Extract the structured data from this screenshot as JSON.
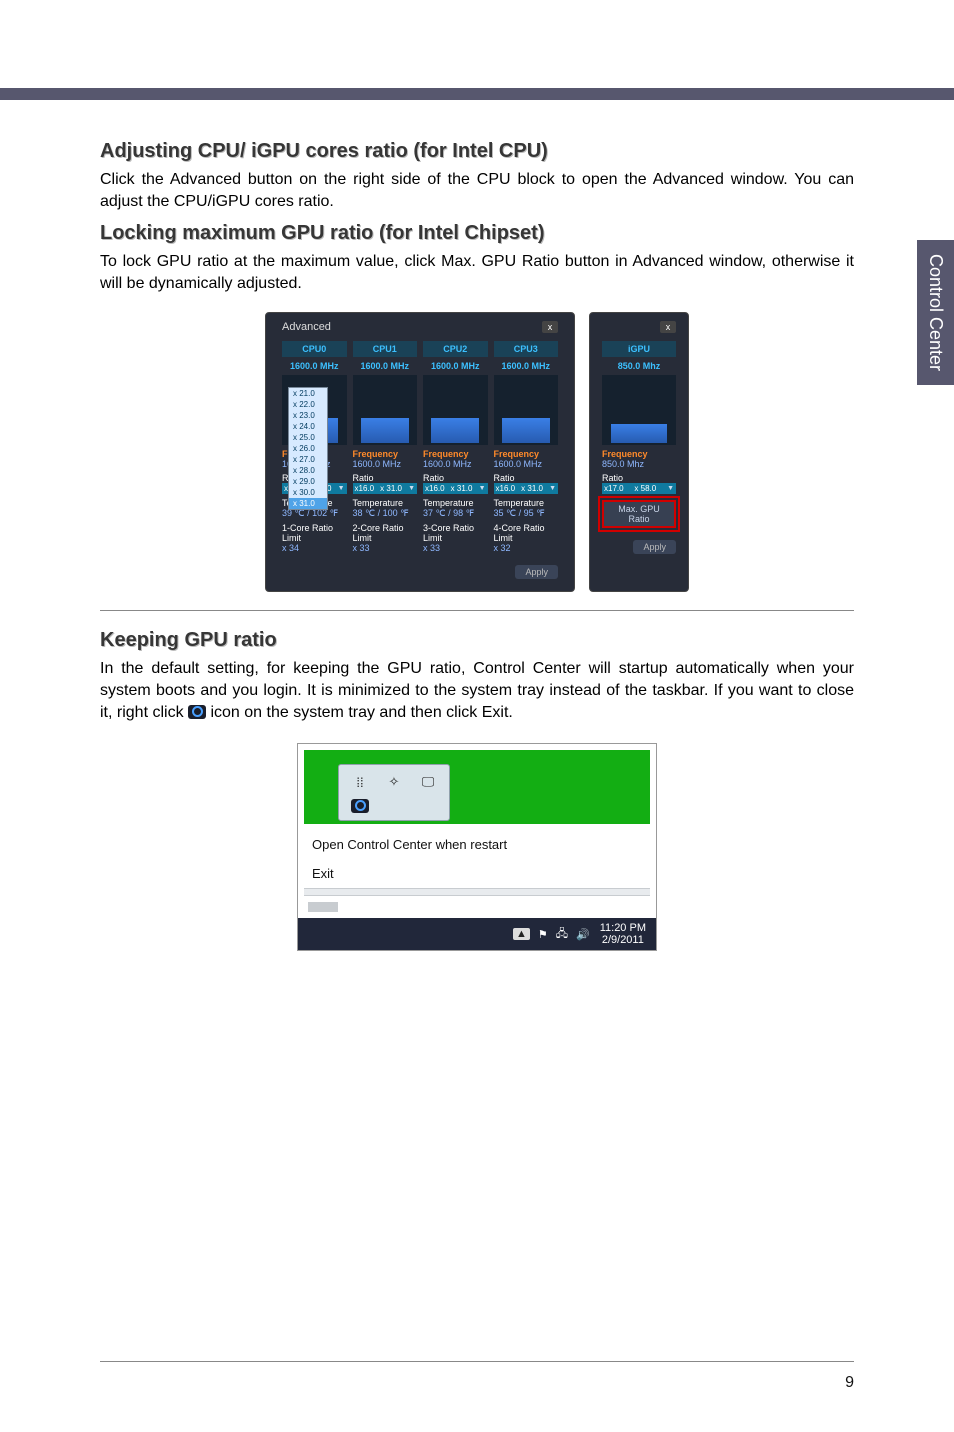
{
  "side_tab": "Control Center",
  "page_number": "9",
  "sections": {
    "s1": {
      "heading": "Adjusting CPU/ iGPU cores ratio (for Intel CPU)",
      "body": "Click the Advanced button on the right side of the CPU block to open the Advanced window. You can adjust the CPU/iGPU cores ratio."
    },
    "s2": {
      "heading": "Locking maximum GPU ratio (for Intel Chipset)",
      "body": "To lock GPU ratio at the maximum value, click Max. GPU Ratio button in Advanced window, otherwise it will be dynamically adjusted."
    },
    "s3": {
      "heading": "Keeping GPU ratio",
      "body_pre": "In the default setting, for keeping the GPU ratio, Control Center will startup automatically when your system boots and you login. It is minimized to the system tray instead of the taskbar. If you want to close it, right click ",
      "body_post": " icon on the system tray and then click Exit."
    }
  },
  "adv": {
    "title": "Advanced",
    "apply": "Apply",
    "labels": {
      "frequency": "Frequency",
      "ratio": "Ratio",
      "temperature": "Temperature",
      "core_ratio_limit_1": "1-Core Ratio Limit",
      "core_ratio_limit_2": "2-Core Ratio Limit",
      "core_ratio_limit_3": "3-Core Ratio Limit",
      "core_ratio_limit_4": "4-Core Ratio Limit"
    },
    "cpus": [
      {
        "name": "CPU0",
        "mhz": "1600.0 MHz",
        "freq": "1600.0 MHz",
        "ratio_lo": "x16.0",
        "ratio_sel": "x 31.0",
        "temp": "39 ℃ / 102 ℉",
        "limit": "x 34"
      },
      {
        "name": "CPU1",
        "mhz": "1600.0 MHz",
        "freq": "1600.0 MHz",
        "ratio_lo": "x16.0",
        "ratio_sel": "x 31.0",
        "temp": "38 ℃ / 100 ℉",
        "limit": "x 33"
      },
      {
        "name": "CPU2",
        "mhz": "1600.0 MHz",
        "freq": "1600.0 MHz",
        "ratio_lo": "x16.0",
        "ratio_sel": "x 31.0",
        "temp": "37 ℃ / 98 ℉",
        "limit": "x 33"
      },
      {
        "name": "CPU3",
        "mhz": "1600.0 MHz",
        "freq": "1600.0 MHz",
        "ratio_lo": "x16.0",
        "ratio_sel": "x 31.0",
        "temp": "35 ℃ / 95 ℉",
        "limit": "x 32"
      }
    ],
    "ratio_options": [
      "x 21.0",
      "x 22.0",
      "x 23.0",
      "x 24.0",
      "x 25.0",
      "x 26.0",
      "x 27.0",
      "x 28.0",
      "x 29.0",
      "x 30.0",
      "x 31.0"
    ]
  },
  "igpu": {
    "name": "iGPU",
    "mhz": "850.0 Mhz",
    "freq": "850.0 Mhz",
    "ratio_lo": "x17.0",
    "ratio_sel": "x 58.0",
    "max_btn": "Max. GPU Ratio",
    "apply": "Apply"
  },
  "tray": {
    "menu": {
      "open": "Open Control Center when restart",
      "exit": "Exit"
    },
    "time": "11:20 PM",
    "date": "2/9/2011"
  }
}
